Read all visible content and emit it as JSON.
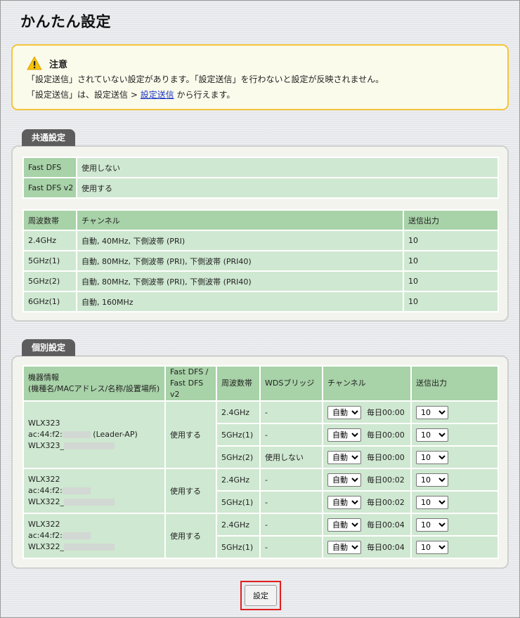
{
  "page_title": "かんたん設定",
  "notice": {
    "title": "注意",
    "line1": "「設定送信」されていない設定があります。「設定送信」を行わないと設定が反映されません。",
    "line2_prefix": "「設定送信」は、設定送信 > ",
    "line2_link": "設定送信",
    "line2_suffix": " から行えます。"
  },
  "common": {
    "tab": "共通設定",
    "dfs_rows": [
      {
        "label": "Fast DFS",
        "value": "使用しない"
      },
      {
        "label": "Fast DFS v2",
        "value": "使用する"
      }
    ],
    "headers": {
      "band": "周波数帯",
      "channel": "チャンネル",
      "power": "送信出力"
    },
    "rows": [
      {
        "band": "2.4GHz",
        "channel": "自動, 40MHz, 下側波帯 (PRI)",
        "power": "10"
      },
      {
        "band": "5GHz(1)",
        "channel": "自動, 80MHz, 下側波帯 (PRI), 下側波帯 (PRI40)",
        "power": "10"
      },
      {
        "band": "5GHz(2)",
        "channel": "自動, 80MHz, 下側波帯 (PRI), 下側波帯 (PRI40)",
        "power": "10"
      },
      {
        "band": "6GHz(1)",
        "channel": "自動, 160MHz",
        "power": "10"
      }
    ]
  },
  "individual": {
    "tab": "個別設定",
    "headers": {
      "device_1": "機器情報",
      "device_2": "(機種名/MACアドレス/名称/設置場所)",
      "dfs_1": "Fast DFS /",
      "dfs_2": "Fast DFS v2",
      "band": "周波数帯",
      "wds": "WDSブリッジ",
      "channel": "チャンネル",
      "power": "送信出力"
    },
    "devices": [
      {
        "model": "WLX323",
        "mac_prefix": "ac:44:f2:",
        "role": " (Leader-AP)",
        "name_prefix": "WLX323_",
        "dfs": "使用する",
        "bands": [
          {
            "band": "2.4GHz",
            "wds": "-",
            "channel": "自動",
            "schedule": "毎日00:00",
            "power": "10"
          },
          {
            "band": "5GHz(1)",
            "wds": "-",
            "channel": "自動",
            "schedule": "毎日00:00",
            "power": "10"
          },
          {
            "band": "5GHz(2)",
            "wds": "使用しない",
            "channel": "自動",
            "schedule": "毎日00:00",
            "power": "10"
          }
        ]
      },
      {
        "model": "WLX322",
        "mac_prefix": "ac:44:f2:",
        "role": "",
        "name_prefix": "WLX322_",
        "dfs": "使用する",
        "bands": [
          {
            "band": "2.4GHz",
            "wds": "-",
            "channel": "自動",
            "schedule": "毎日00:02",
            "power": "10"
          },
          {
            "band": "5GHz(1)",
            "wds": "-",
            "channel": "自動",
            "schedule": "毎日00:02",
            "power": "10"
          }
        ]
      },
      {
        "model": "WLX322",
        "mac_prefix": "ac:44:f2:",
        "role": "",
        "name_prefix": "WLX322_",
        "dfs": "使用する",
        "bands": [
          {
            "band": "2.4GHz",
            "wds": "-",
            "channel": "自動",
            "schedule": "毎日00:04",
            "power": "10"
          },
          {
            "band": "5GHz(1)",
            "wds": "-",
            "channel": "自動",
            "schedule": "毎日00:04",
            "power": "10"
          }
        ]
      }
    ]
  },
  "submit_label": "設定",
  "icons": {
    "warning": "warning-triangle-icon"
  },
  "colors": {
    "accent": "#f5c53a",
    "header_green": "#a8d2a8",
    "cell_green": "#cfe8d1",
    "tab": "#5d5d5d",
    "highlight": "#e01f1f",
    "link": "#1a35c4"
  }
}
